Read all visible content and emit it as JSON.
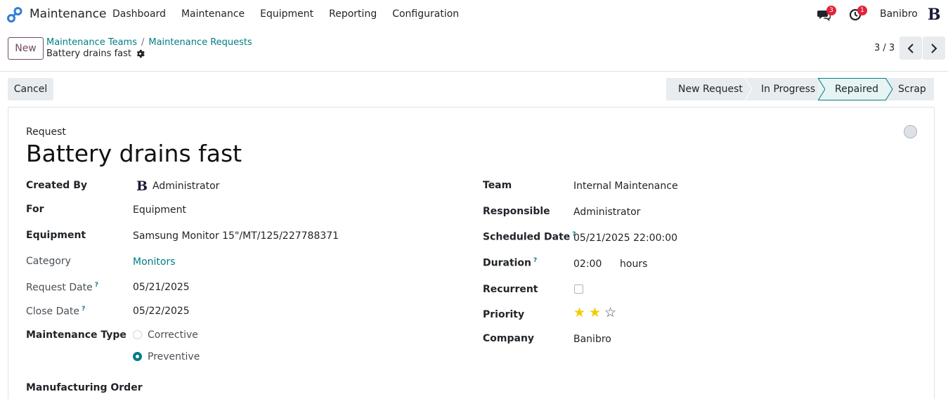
{
  "navbar": {
    "app_name": "Maintenance",
    "menu": [
      "Dashboard",
      "Maintenance",
      "Equipment",
      "Reporting",
      "Configuration"
    ],
    "messages_badge": "3",
    "activities_badge": "1",
    "company": "Banibro",
    "avatar_letter": "B"
  },
  "control": {
    "new_label": "New",
    "breadcrumbs": [
      "Maintenance Teams",
      "Maintenance Requests"
    ],
    "breadcrumb_sep": "/",
    "record_name": "Battery drains fast",
    "pager": "3 / 3"
  },
  "statusbar": {
    "cancel_label": "Cancel",
    "stages": [
      "New Request",
      "In Progress",
      "Repaired",
      "Scrap"
    ],
    "active_stage": "Repaired"
  },
  "form": {
    "title_label": "Request",
    "title": "Battery drains fast",
    "left": {
      "created_by_label": "Created By",
      "created_by_avatar": "B",
      "created_by": "Administrator",
      "for_label": "For",
      "for": "Equipment",
      "equipment_label": "Equipment",
      "equipment": "Samsung Monitor 15\"/MT/125/227788371",
      "category_label": "Category",
      "category": "Monitors",
      "request_date_label": "Request Date",
      "request_date": "05/21/2025",
      "close_date_label": "Close Date",
      "close_date": "05/22/2025",
      "maintenance_type_label": "Maintenance Type",
      "type_options": [
        "Corrective",
        "Preventive"
      ],
      "type_selected": "Preventive",
      "manufacturing_order_label": "Manufacturing Order"
    },
    "right": {
      "team_label": "Team",
      "team": "Internal Maintenance",
      "responsible_label": "Responsible",
      "responsible": "Administrator",
      "scheduled_date_label": "Scheduled Date",
      "scheduled_date": "05/21/2025 22:00:00",
      "duration_label": "Duration",
      "duration": "02:00",
      "duration_unit": "hours",
      "recurrent_label": "Recurrent",
      "recurrent": false,
      "priority_label": "Priority",
      "priority": 2,
      "priority_max": 3,
      "company_label": "Company",
      "company": "Banibro"
    },
    "help_mark": "?"
  },
  "colors": {
    "primary": "#714b67",
    "link": "#017e84",
    "star": "#f3cc00",
    "badge": "#e0243a"
  }
}
